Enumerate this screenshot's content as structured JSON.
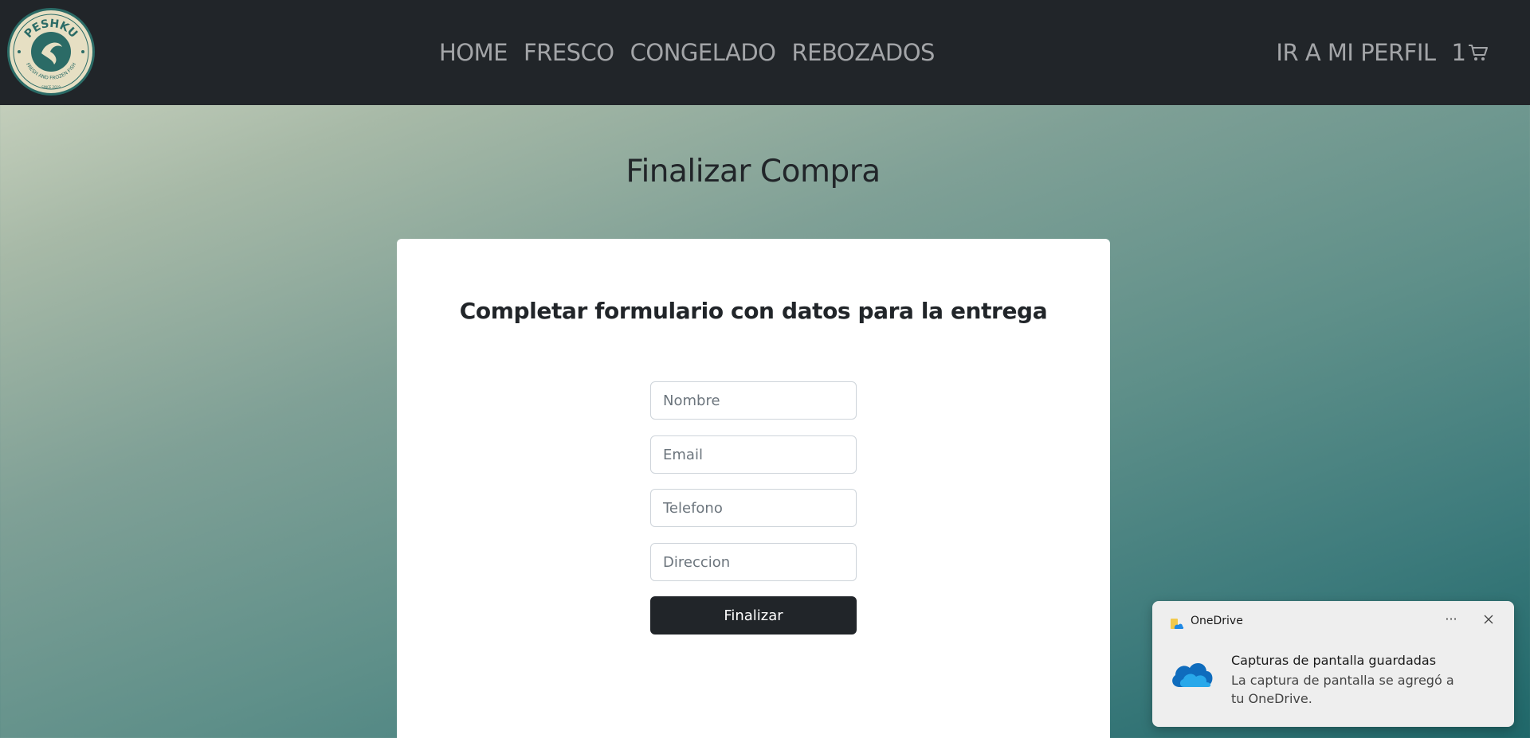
{
  "brand": {
    "logo_text": "PESHKU",
    "logo_tagline": "FRESH AND FROZEN FISH",
    "logo_since": "SINCE 2019"
  },
  "nav": {
    "links": [
      "HOME",
      "FRESCO",
      "CONGELADO",
      "REBOZADOS"
    ],
    "profile": "IR A MI PERFIL",
    "cart_count": "1",
    "cart_icon": "cart-icon"
  },
  "page": {
    "title": "Finalizar Compra"
  },
  "form": {
    "title": "Completar formulario con datos para la entrega",
    "fields": {
      "nombre": {
        "placeholder": "Nombre",
        "value": ""
      },
      "email": {
        "placeholder": "Email",
        "value": ""
      },
      "telefono": {
        "placeholder": "Telefono",
        "value": ""
      },
      "direccion": {
        "placeholder": "Direccion",
        "value": ""
      }
    },
    "submit_label": "Finalizar"
  },
  "toast": {
    "app": "OneDrive",
    "more": "···",
    "title": "Capturas de pantalla guardadas",
    "body": "La captura de pantalla se agregó a tu OneDrive."
  },
  "colors": {
    "navbar": "#212529",
    "nav_text": "#a3a5a8",
    "button": "#212529",
    "card": "#ffffff"
  }
}
